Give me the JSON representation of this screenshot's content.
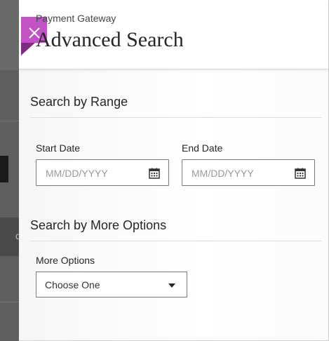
{
  "header": {
    "breadcrumb": "Payment Gateway",
    "title": "Advanced Search",
    "close_icon": "close-icon",
    "accent_color": "#c153c7"
  },
  "range_section": {
    "title": "Search by Range",
    "start_date": {
      "label": "Start Date",
      "placeholder": "MM/DD/YYYY",
      "icon": "calendar-icon"
    },
    "end_date": {
      "label": "End Date",
      "placeholder": "MM/DD/YYYY",
      "icon": "calendar-icon"
    }
  },
  "options_section": {
    "title": "Search by More Options",
    "more_options": {
      "label": "More Options",
      "selected": "Choose One",
      "icon": "chevron-down-icon"
    }
  }
}
